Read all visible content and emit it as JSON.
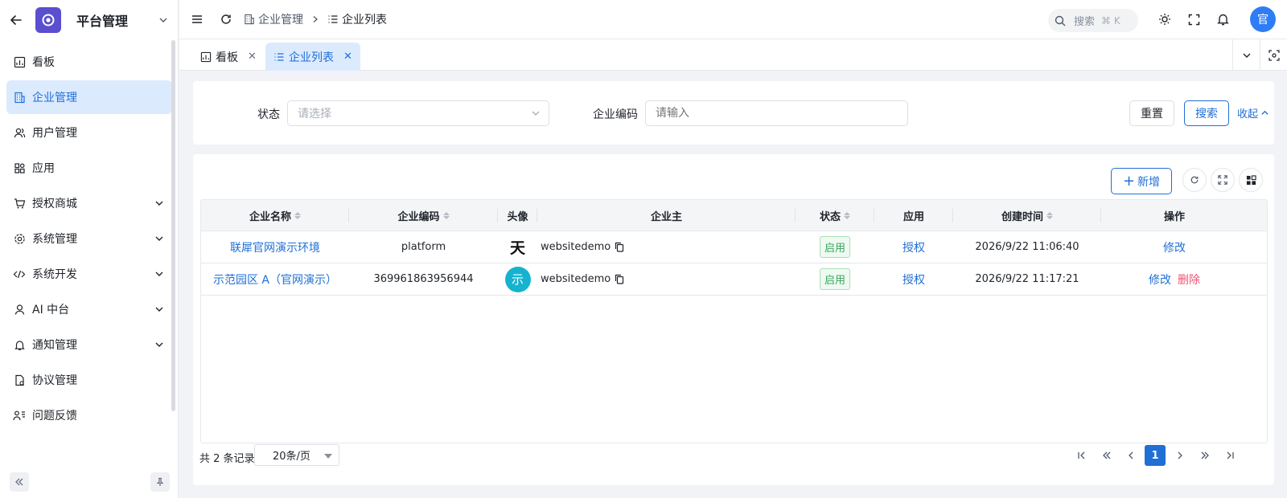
{
  "sidebar": {
    "title": "平台管理",
    "items": [
      {
        "label": "看板",
        "icon": "dashboard-icon",
        "active": false,
        "expandable": false
      },
      {
        "label": "企业管理",
        "icon": "building-icon",
        "active": true,
        "expandable": false
      },
      {
        "label": "用户管理",
        "icon": "users-icon",
        "active": false,
        "expandable": false
      },
      {
        "label": "应用",
        "icon": "apps-icon",
        "active": false,
        "expandable": false
      },
      {
        "label": "授权商城",
        "icon": "cart-icon",
        "active": false,
        "expandable": true
      },
      {
        "label": "系统管理",
        "icon": "gear-icon",
        "active": false,
        "expandable": true
      },
      {
        "label": "系统开发",
        "icon": "code-icon",
        "active": false,
        "expandable": true
      },
      {
        "label": "AI 中台",
        "icon": "robot-icon",
        "active": false,
        "expandable": true
      },
      {
        "label": "通知管理",
        "icon": "bell-icon",
        "active": false,
        "expandable": true
      },
      {
        "label": "协议管理",
        "icon": "file-icon",
        "active": false,
        "expandable": false
      },
      {
        "label": "问题反馈",
        "icon": "feedback-icon",
        "active": false,
        "expandable": false
      }
    ]
  },
  "header": {
    "breadcrumb": [
      "企业管理",
      "企业列表"
    ],
    "search_placeholder": "搜索",
    "search_shortcut": "⌘ K",
    "avatar_text": "官"
  },
  "tabs": [
    {
      "label": "看板",
      "active": false
    },
    {
      "label": "企业列表",
      "active": true
    }
  ],
  "filter": {
    "status_label": "状态",
    "status_placeholder": "请选择",
    "code_label": "企业编码",
    "code_placeholder": "请输入",
    "reset_label": "重置",
    "search_label": "搜索",
    "collapse_label": "收起"
  },
  "toolbar": {
    "add_label": "新增"
  },
  "table": {
    "columns": [
      "企业名称",
      "企业编码",
      "头像",
      "企业主",
      "状态",
      "应用",
      "创建时间",
      "操作"
    ],
    "rows": [
      {
        "name": "联犀官网演示环境",
        "code": "platform",
        "avatar": "logo",
        "owner": "websitedemo",
        "status": "启用",
        "app": "授权",
        "created": "2026/9/22 11:06:40",
        "actions": [
          "修改"
        ]
      },
      {
        "name": "示范园区 A（官网演示）",
        "code": "369961863956944",
        "avatar": "示",
        "owner": "websitedemo",
        "status": "启用",
        "app": "授权",
        "created": "2026/9/22 11:17:21",
        "actions": [
          "修改",
          "删除"
        ]
      }
    ]
  },
  "pagination": {
    "total_text": "共 2 条记录",
    "page_size": "20条/页",
    "current_page": "1"
  },
  "colors": {
    "primary": "#1f6fd6",
    "active_bg": "#dceafe",
    "danger": "#f0506e",
    "success": "#3aa55a",
    "logo": "#5a4fcf"
  }
}
